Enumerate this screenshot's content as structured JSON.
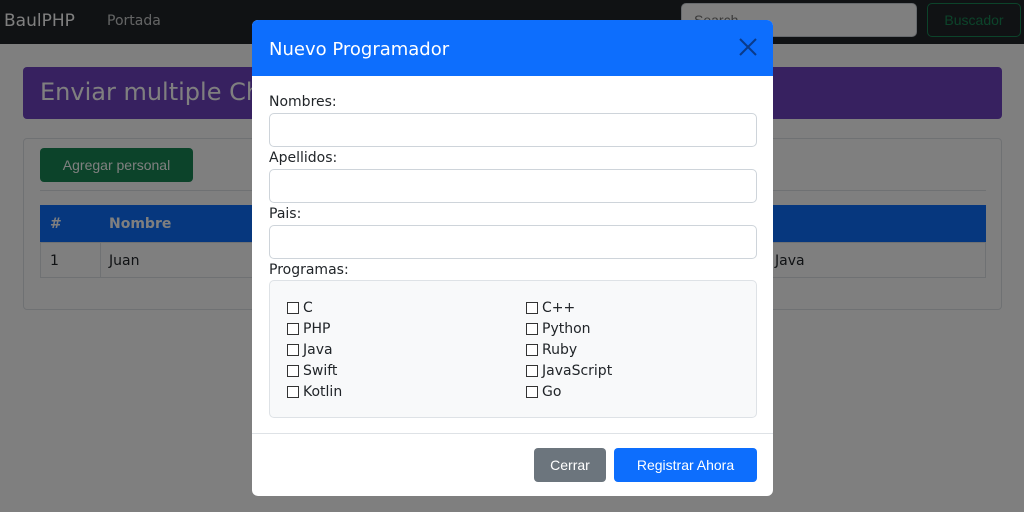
{
  "navbar": {
    "brand": "BaulPHP",
    "link": "Portada",
    "search_placeholder": "Search",
    "search_button": "Buscador"
  },
  "page": {
    "title": "Enviar multiple Checkbox",
    "add_button": "Agregar personal",
    "table": {
      "headers": [
        "#",
        "Nombre"
      ],
      "rows": [
        {
          "id": "1",
          "nombre": "Juan",
          "programas": "Java"
        }
      ]
    }
  },
  "modal": {
    "title": "Nuevo Programador",
    "fields": [
      {
        "label": "Nombres:",
        "value": ""
      },
      {
        "label": "Apellidos:",
        "value": ""
      },
      {
        "label": "Pais:",
        "value": ""
      }
    ],
    "programs_label": "Programas:",
    "programs": [
      [
        "C",
        "C++"
      ],
      [
        "PHP",
        "Python"
      ],
      [
        "Java",
        "Ruby"
      ],
      [
        "Swift",
        "JavaScript"
      ],
      [
        "Kotlin",
        "Go"
      ]
    ],
    "close_button": "Cerrar",
    "submit_button": "Registrar Ahora"
  },
  "colors": {
    "primary": "#0d6efd",
    "success": "#198754",
    "purple": "#6f42c1",
    "secondary": "#6c757d"
  }
}
